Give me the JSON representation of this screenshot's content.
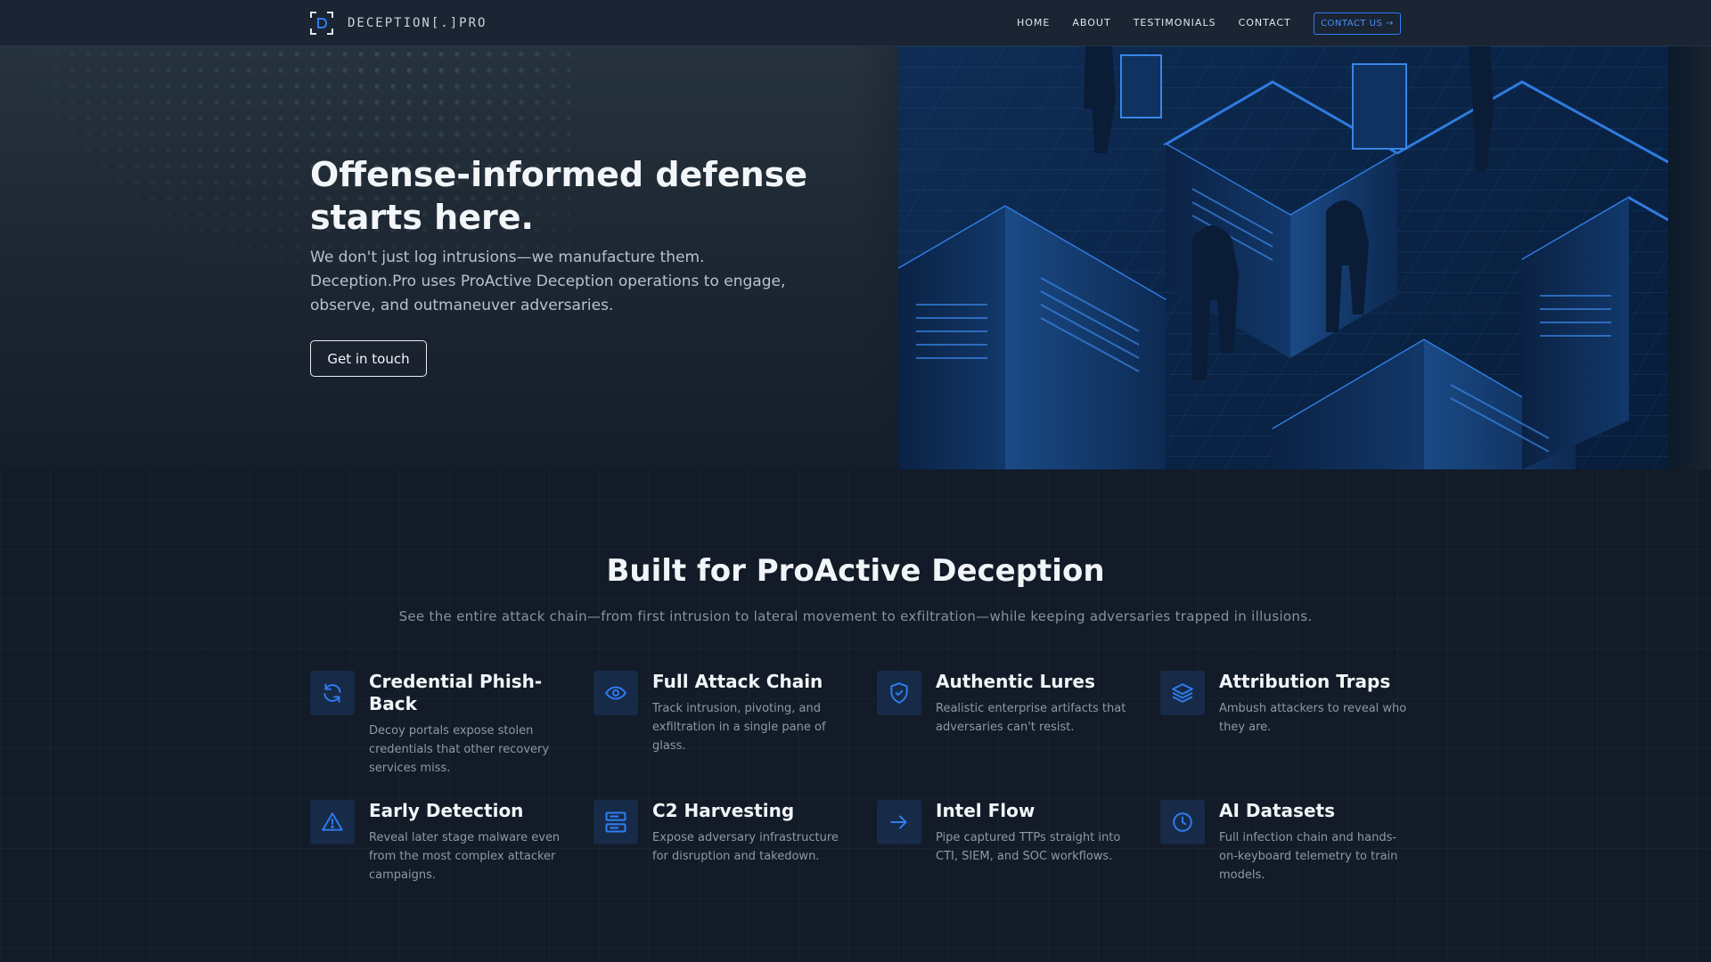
{
  "brand": {
    "name": "DECEPTION[.]PRO",
    "icon": "bracket-d-logo-icon"
  },
  "nav": {
    "links": [
      "HOME",
      "ABOUT",
      "TESTIMONIALS",
      "CONTACT"
    ],
    "cta": "CONTACT US →"
  },
  "hero": {
    "title": "Offense-informed defense starts here.",
    "subtitle": "We don't just log intrusions—we manufacture them. Deception.Pro uses ProActive Deception operations to engage, observe, and outmaneuver adversaries.",
    "button": "Get in touch",
    "image": "isometric-server-maze-hooded-figures-illustration"
  },
  "features": {
    "title": "Built for ProActive Deception",
    "subtitle": "See the entire attack chain—from first intrusion to lateral movement to exfiltration—while keeping adversaries trapped in illusions.",
    "items": [
      {
        "title": "Credential Phish-Back",
        "desc": "Decoy portals expose stolen credentials that other recovery services miss.",
        "icon": "refresh-icon"
      },
      {
        "title": "Full Attack Chain",
        "desc": "Track intrusion, pivoting, and exfiltration in a single pane of glass.",
        "icon": "eye-icon"
      },
      {
        "title": "Authentic Lures",
        "desc": "Realistic enterprise artifacts that adversaries can't resist.",
        "icon": "shield-check-icon"
      },
      {
        "title": "Attribution Traps",
        "desc": "Ambush attackers to reveal who they are.",
        "icon": "layers-icon"
      },
      {
        "title": "Early Detection",
        "desc": "Reveal later stage malware even from the most complex attacker campaigns.",
        "icon": "warning-icon"
      },
      {
        "title": "C2 Harvesting",
        "desc": "Expose adversary infrastructure for disruption and takedown.",
        "icon": "server-icon"
      },
      {
        "title": "Intel Flow",
        "desc": "Pipe captured TTPs straight into CTI, SIEM, and SOC workflows.",
        "icon": "arrow-right-icon"
      },
      {
        "title": "AI Datasets",
        "desc": "Full infection chain and hands-on-keyboard telemetry to train models.",
        "icon": "clock-icon"
      }
    ]
  },
  "colors": {
    "accent": "#2e7df0",
    "background": "#121b27",
    "nav": "#1a2433",
    "icon_tile": "#172a47"
  }
}
